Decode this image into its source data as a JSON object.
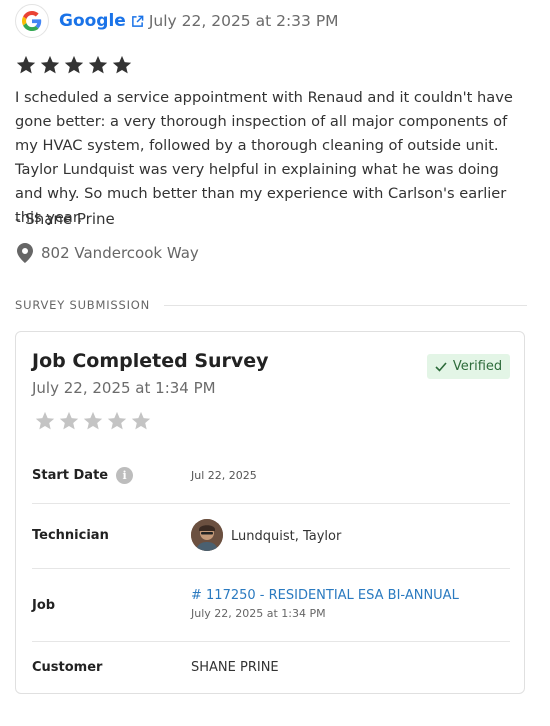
{
  "review": {
    "source": "Google",
    "date": "July 22, 2025 at 2:33 PM",
    "rating": 5,
    "text": "I scheduled a service appointment with Renaud and it couldn't have gone better: a very thorough inspection of all major components of my HVAC system, followed by a thorough cleaning of outside unit. Taylor Lundquist was very helpful in explaining what he was doing and why. So much better than my experience with Carlson's earlier this year.",
    "author": "- Shane Prine",
    "location": "802 Vandercook Way",
    "icons": {
      "logo": "google-g-icon",
      "external": "external-link-icon",
      "star": "star-icon",
      "location": "map-pin-icon"
    },
    "star_color": "#333333"
  },
  "section": {
    "label": "SURVEY SUBMISSION"
  },
  "survey": {
    "title": "Job Completed Survey",
    "date": "July 22, 2025 at 1:34 PM",
    "verified_label": "Verified",
    "rating": 0,
    "empty_star_color": "#c4c4c4",
    "fields": {
      "start_date": {
        "label": "Start Date",
        "value": "Jul 22, 2025",
        "info_icon": "i"
      },
      "technician": {
        "label": "Technician",
        "value": "Lundquist, Taylor"
      },
      "job": {
        "label": "Job",
        "link": "# 117250 - RESIDENTIAL ESA BI-ANNUAL",
        "sub": "July 22, 2025 at 1:34 PM"
      },
      "customer": {
        "label": "Customer",
        "value": "SHANE PRINE"
      }
    }
  }
}
